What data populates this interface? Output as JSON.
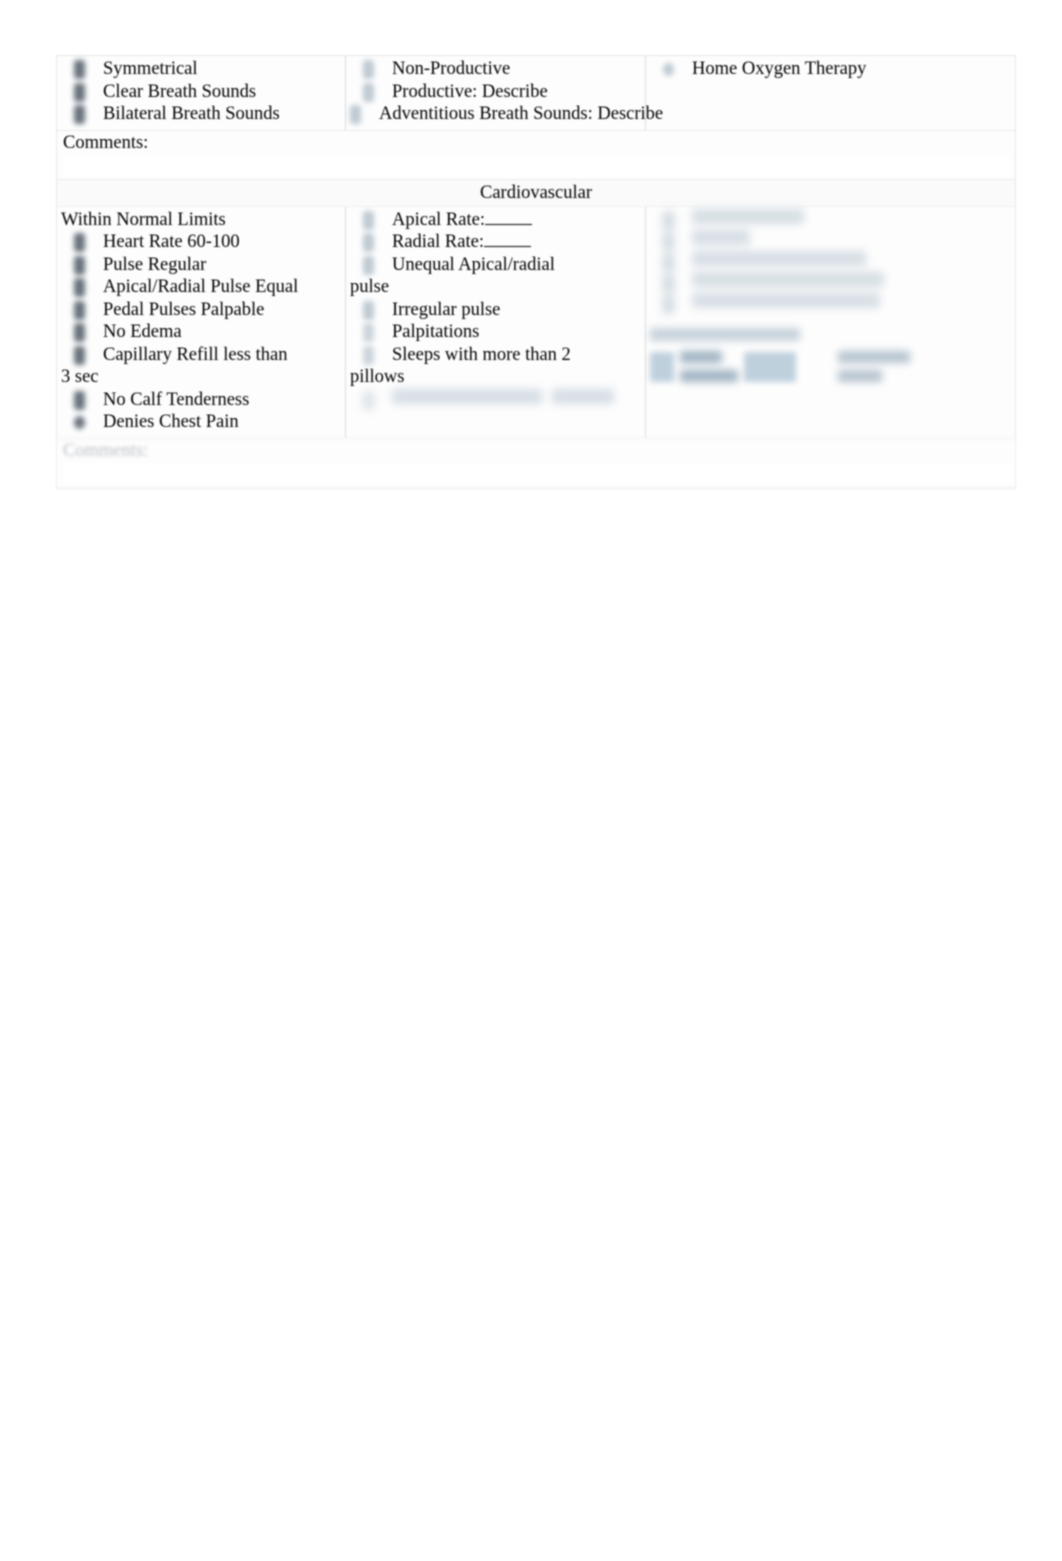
{
  "document": {
    "type": "nursing-assessment-checklist-form"
  },
  "respiratory": {
    "columns": [
      {
        "name": "respiratory-normal-findings",
        "options": [
          {
            "label": "Symmetrical",
            "marker": "checkbox-dark"
          },
          {
            "label": "Clear Breath Sounds",
            "marker": "checkbox-dark"
          },
          {
            "label": "Bilateral Breath Sounds",
            "marker": "checkbox-dark"
          }
        ]
      },
      {
        "name": "respiratory-cough-findings",
        "options": [
          {
            "label": "Non-Productive",
            "marker": "checkbox-light"
          },
          {
            "label": "Productive: Describe",
            "marker": "checkbox-light"
          },
          {
            "label": "Adventitious Breath Sounds: Describe",
            "marker": "checkbox-light",
            "fill_in": true
          }
        ]
      },
      {
        "name": "respiratory-oxygen",
        "options": [
          {
            "label": "Home Oxygen Therapy",
            "marker": "checkbox-light-round"
          }
        ]
      }
    ],
    "comments_label": "Comments:"
  },
  "cardiovascular": {
    "title": "Cardiovascular",
    "column_1": {
      "heading": "Within Normal Limits",
      "options": [
        {
          "label": "Heart Rate 60-100"
        },
        {
          "label": "Pulse Regular"
        },
        {
          "label": "Apical/Radial Pulse Equal"
        },
        {
          "label": "Pedal Pulses Palpable"
        },
        {
          "label": "No Edema"
        },
        {
          "label": "Capillary Refill less than",
          "continuation": "3 sec"
        },
        {
          "label": "No Calf Tenderness"
        },
        {
          "label": "Denies Chest Pain"
        }
      ]
    },
    "column_2": {
      "options": [
        {
          "label": "Apical Rate:",
          "fill_in": "short"
        },
        {
          "label": "Radial Rate:",
          "fill_in": "short"
        },
        {
          "label": "Unequal Apical/radial",
          "continuation": "pulse"
        },
        {
          "label": "Irregular pulse"
        },
        {
          "label": "Palpitations"
        },
        {
          "label": "Sleeps with more than 2",
          "continuation": "pillows"
        },
        {
          "label": "",
          "illegible": true
        }
      ]
    },
    "column_3": {
      "legible": false,
      "note": "illegible blurred text block",
      "lines": [
        "",
        "",
        "",
        "",
        ""
      ],
      "subheading": "",
      "mini_rows": [
        {
          "left": "",
          "right": ""
        },
        {
          "left": "",
          "right": ""
        }
      ]
    },
    "comments_label": "Comments:"
  },
  "colors": {
    "checkbox_dark": "#4e5a66",
    "checkbox_light": "#b6c3cd",
    "page_background": "#ffffff",
    "form_background": "#fdfdfd",
    "divider": "#dddddd",
    "text": "#000000"
  }
}
